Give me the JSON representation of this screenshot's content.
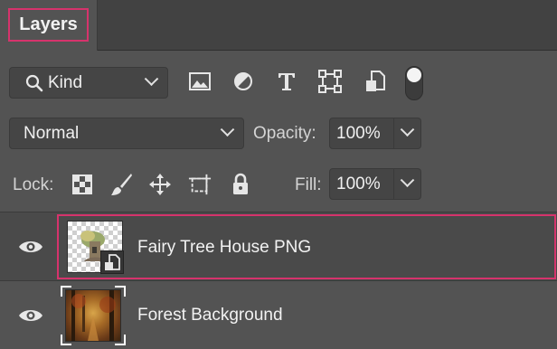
{
  "panel": {
    "tab_label": "Layers"
  },
  "filter": {
    "kind_label": "Kind",
    "icons": [
      "search-icon",
      "image-filter-icon",
      "adjustment-filter-icon",
      "type-filter-icon",
      "shape-filter-icon",
      "smart-object-filter-icon"
    ],
    "toggle_state": "on"
  },
  "blend": {
    "mode": "Normal",
    "opacity_label": "Opacity:",
    "opacity_value": "100%"
  },
  "lock": {
    "label": "Lock:",
    "icons": [
      "lock-transparent-pixels-icon",
      "lock-image-pixels-icon",
      "lock-position-icon",
      "lock-artboard-icon",
      "lock-all-icon"
    ],
    "fill_label": "Fill:",
    "fill_value": "100%"
  },
  "layers": [
    {
      "name": "Fairy Tree House PNG",
      "visible": true,
      "selected": true,
      "type": "smart-object"
    },
    {
      "name": "Forest Background",
      "visible": true,
      "selected": false,
      "type": "background"
    }
  ],
  "colors": {
    "panel_bg": "#535353",
    "highlight": "#d6336c",
    "selected_layer_bg": "#4a4a4a"
  }
}
